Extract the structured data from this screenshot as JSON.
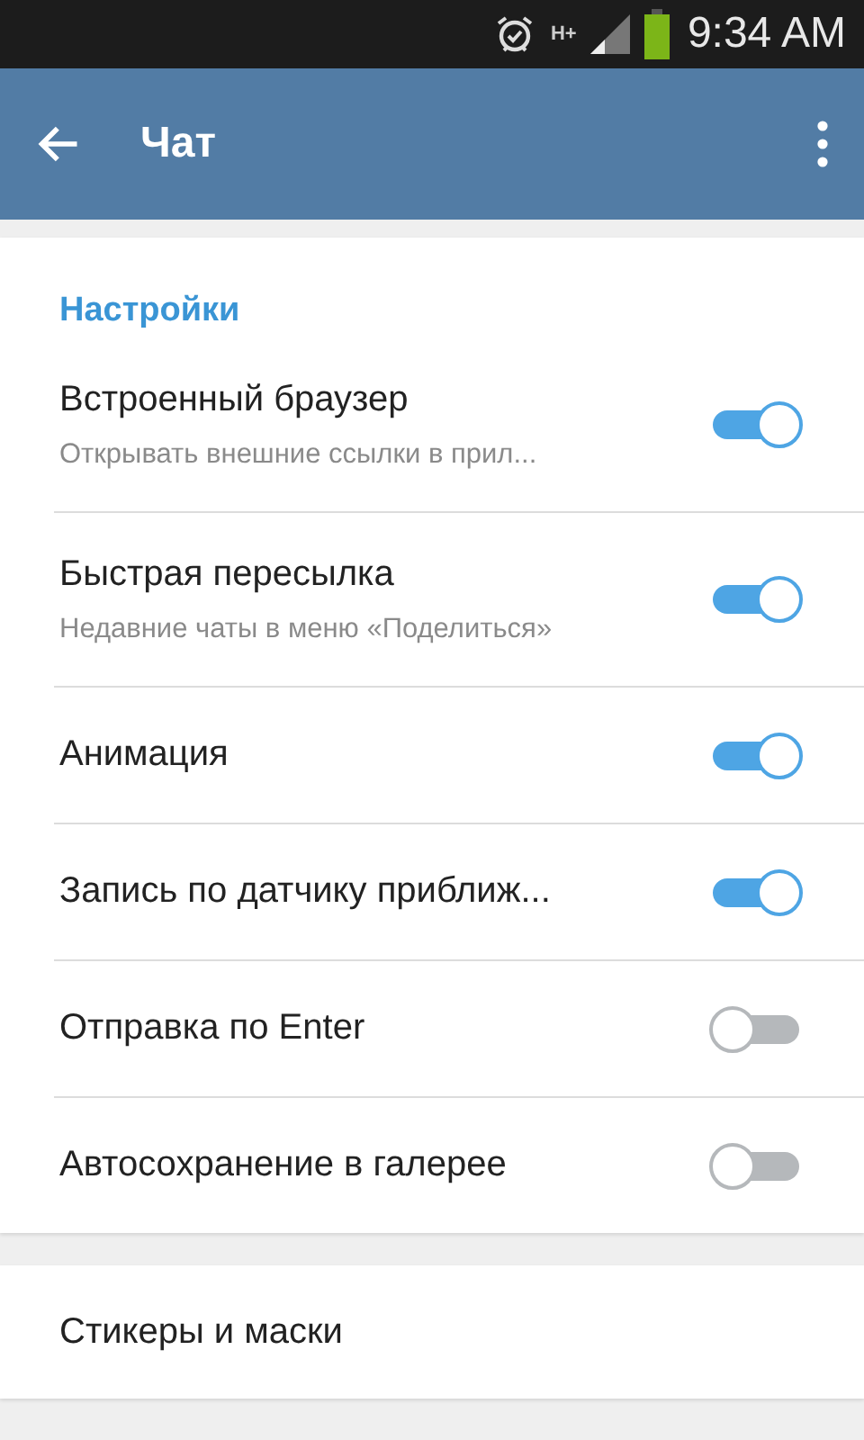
{
  "status_bar": {
    "time": "9:34 AM",
    "network": "H+"
  },
  "app_bar": {
    "title": "Чат"
  },
  "section": {
    "header": "Настройки",
    "rows": [
      {
        "title": "Встроенный браузер",
        "subtitle": "Открывать внешние ссылки в прил...",
        "on": true
      },
      {
        "title": "Быстрая пересылка",
        "subtitle": "Недавние чаты в меню «Поделиться»",
        "on": true
      },
      {
        "title": "Анимация",
        "on": true
      },
      {
        "title": "Запись по датчику приближ...",
        "on": true
      },
      {
        "title": "Отправка по Enter",
        "on": false
      },
      {
        "title": "Автосохранение в галерее",
        "on": false
      }
    ]
  },
  "links": [
    {
      "title": "Стикеры и маски"
    }
  ]
}
